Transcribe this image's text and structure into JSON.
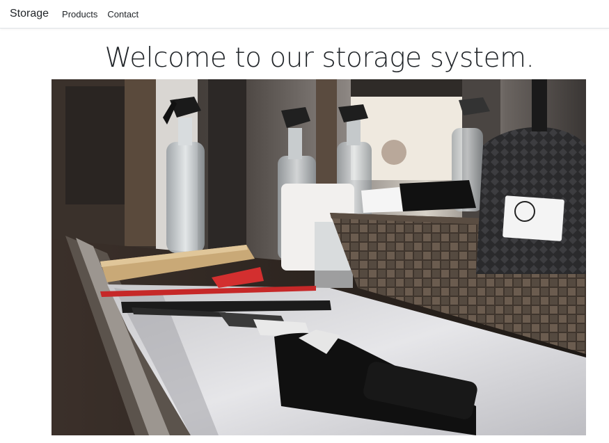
{
  "navbar": {
    "brand": "Storage",
    "links": [
      {
        "label": "Products"
      },
      {
        "label": "Contact"
      }
    ]
  },
  "main": {
    "heading": "Welcome to our storage system."
  },
  "photo": {
    "subject": "barbershop-counter-icon"
  },
  "colors": {
    "navbar_bg": "#ffffff",
    "navbar_border": "#dee2e6",
    "text": "#212529",
    "page_bg": "#ffffff"
  }
}
